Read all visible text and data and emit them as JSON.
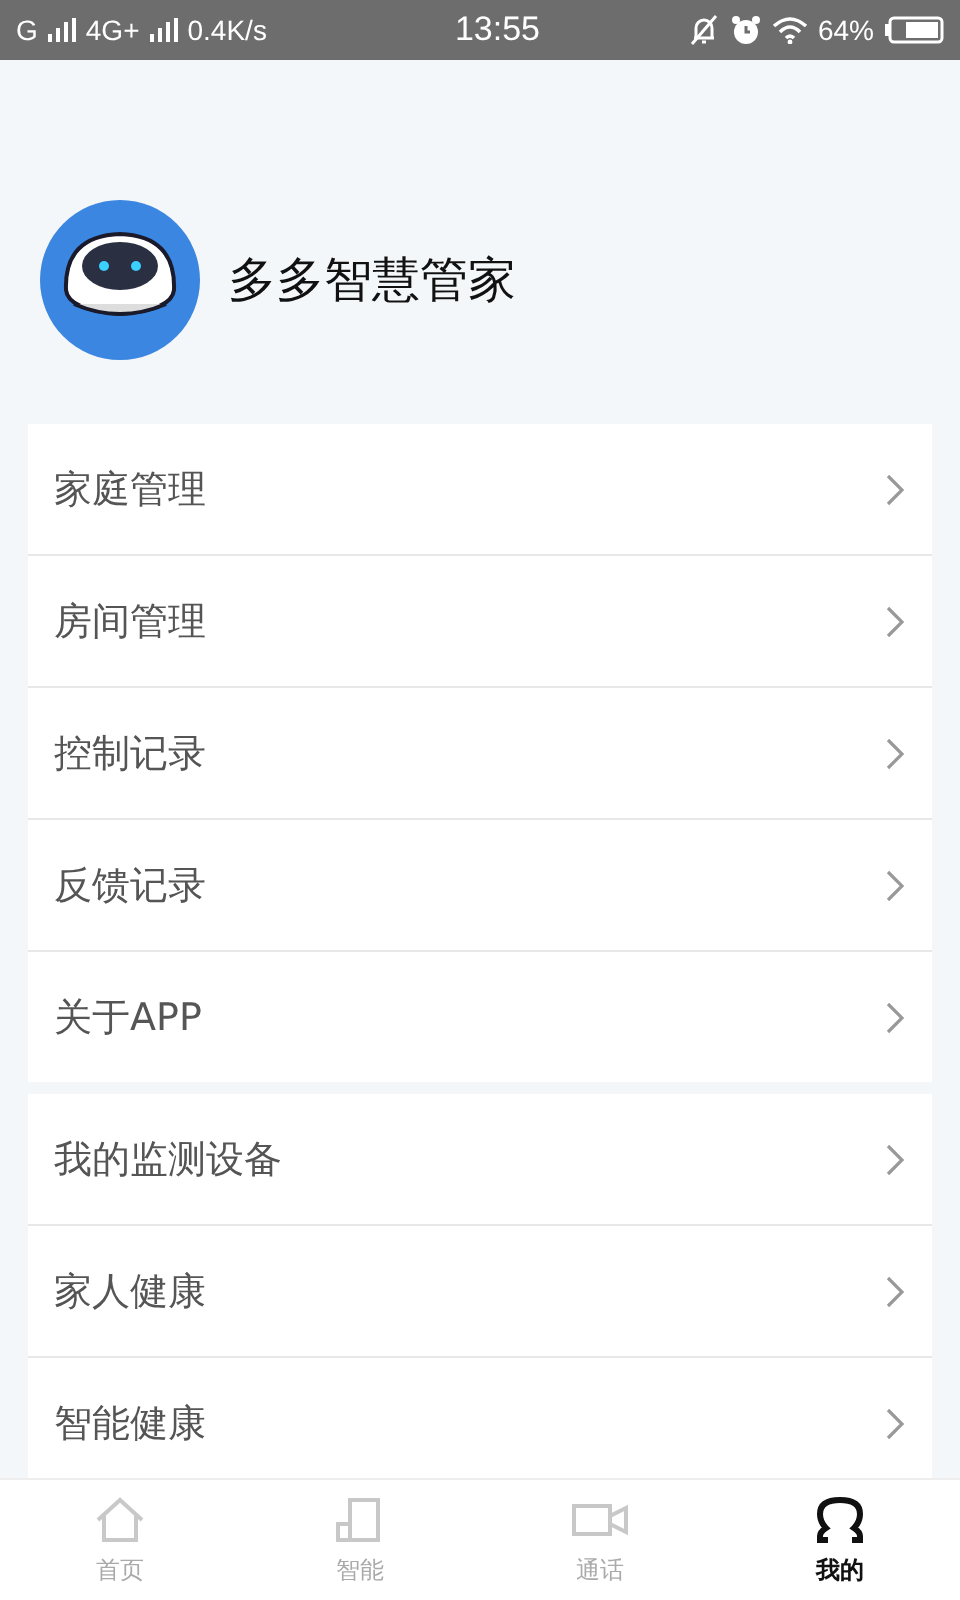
{
  "status_bar": {
    "network_1": "G",
    "network_2": "4G+",
    "speed": "0.4K/s",
    "time": "13:55",
    "battery": "64%"
  },
  "profile": {
    "name": "多多智慧管家"
  },
  "groups": [
    {
      "items": [
        {
          "label": "家庭管理"
        },
        {
          "label": "房间管理"
        },
        {
          "label": "控制记录"
        },
        {
          "label": "反馈记录"
        },
        {
          "label": "关于APP"
        }
      ]
    },
    {
      "items": [
        {
          "label": "我的监测设备"
        },
        {
          "label": "家人健康"
        },
        {
          "label": "智能健康"
        }
      ]
    }
  ],
  "tabs": [
    {
      "kind": "home",
      "label": "首页",
      "selected": false
    },
    {
      "kind": "smart",
      "label": "智能",
      "selected": false
    },
    {
      "kind": "call",
      "label": "通话",
      "selected": false
    },
    {
      "kind": "mine",
      "label": "我的",
      "selected": true
    }
  ]
}
